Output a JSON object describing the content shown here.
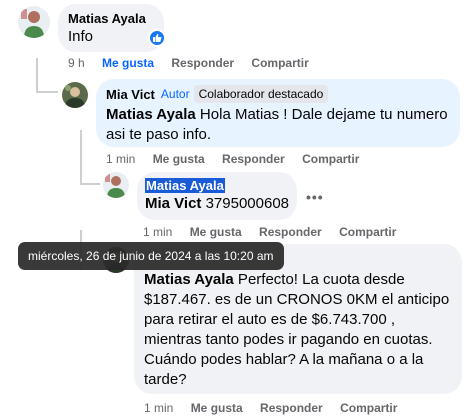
{
  "comment1": {
    "author": "Matias Ayala",
    "text": "Info",
    "time": "9 h",
    "like": "Me gusta",
    "reply": "Responder",
    "share": "Compartir"
  },
  "reply1": {
    "author": "Mia Vict",
    "role": "Autor",
    "badge": "Colaborador destacado",
    "mention": "Matias Ayala",
    "text": " Hola Matias ! Dale dejame tu numero asi te paso info.",
    "time": "1 min",
    "like": "Me gusta",
    "reply": "Responder",
    "share": "Compartir"
  },
  "reply2": {
    "author": "Matias Ayala",
    "mention": "Mia Vict",
    "text": " 3795000608",
    "time": "1 min",
    "like": "Me gusta",
    "reply": "Responder",
    "share": "Compartir",
    "more": "•••"
  },
  "tooltip": {
    "text": "miércoles, 26 de junio de 2024 a las 10:20 am"
  },
  "reply3": {
    "mention": "Matias Ayala",
    "text": " Perfecto! La cuota desde $187.467. es de un CRONOS 0KM el anticipo para retirar el auto es de $6.743.700 , mientras tanto podes ir pagando en cuotas. Cuándo podes hablar? A la mañana o a la tarde?",
    "time": "1 min",
    "like": "Me gusta",
    "reply": "Responder",
    "share": "Compartir"
  },
  "colors": {
    "accent": "#0866ff",
    "bubble": "#f0f2f5",
    "highlight": "#1a5cd8"
  }
}
